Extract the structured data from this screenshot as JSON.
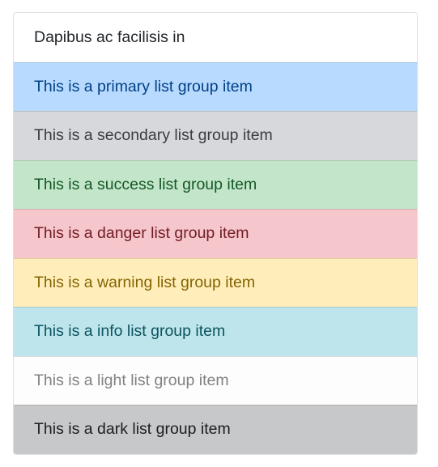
{
  "list_group": {
    "items": [
      {
        "label": "Dapibus ac facilisis in",
        "variant": "default",
        "bg": "#ffffff",
        "color": "#212529"
      },
      {
        "label": "This is a primary list group item",
        "variant": "primary",
        "bg": "#b8daff",
        "color": "#004085"
      },
      {
        "label": "This is a secondary list group item",
        "variant": "secondary",
        "bg": "#d6d8db",
        "color": "#383d41"
      },
      {
        "label": "This is a success list group item",
        "variant": "success",
        "bg": "#c3e6cb",
        "color": "#155724"
      },
      {
        "label": "This is a danger list group item",
        "variant": "danger",
        "bg": "#f5c6cb",
        "color": "#721c24"
      },
      {
        "label": "This is a warning list group item",
        "variant": "warning",
        "bg": "#ffeeba",
        "color": "#856404"
      },
      {
        "label": "This is a info list group item",
        "variant": "info",
        "bg": "#bee5eb",
        "color": "#0c5460"
      },
      {
        "label": "This is a light list group item",
        "variant": "light",
        "bg": "#fdfdfe",
        "color": "#818182"
      },
      {
        "label": "This is a dark list group item",
        "variant": "dark",
        "bg": "#c6c8ca",
        "color": "#1b1e21"
      }
    ]
  }
}
